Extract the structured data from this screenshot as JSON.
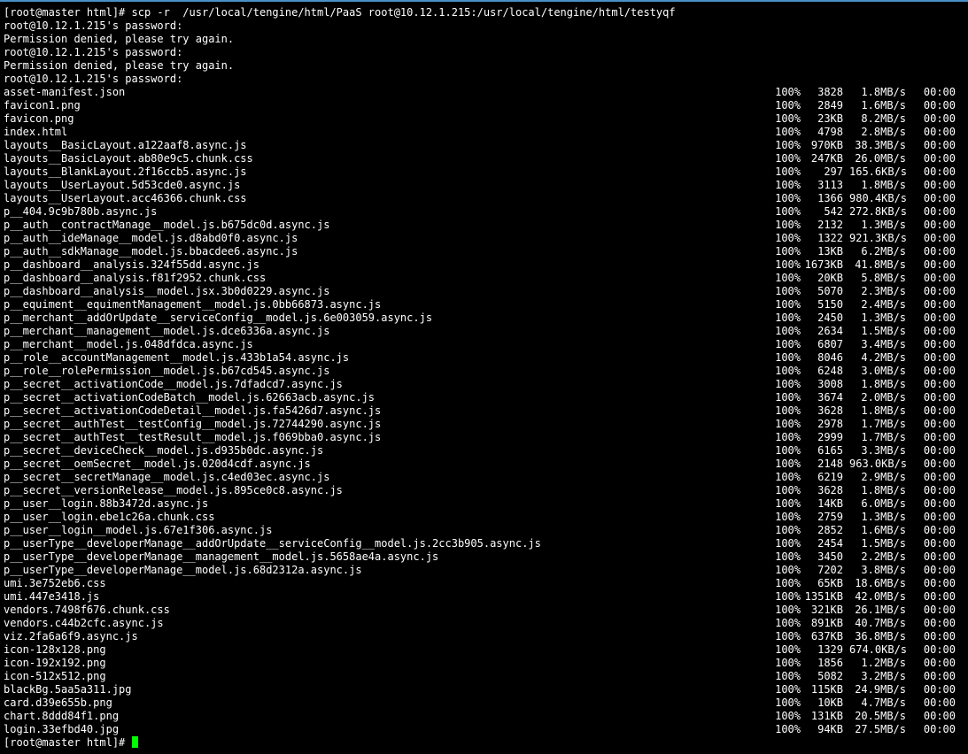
{
  "terminal": {
    "command_line": "[root@master html]# scp -r  /usr/local/tengine/html/PaaS root@10.12.1.215:/usr/local/tengine/html/testyqf",
    "auth_messages": [
      "root@10.12.1.215's password:",
      "Permission denied, please try again.",
      "root@10.12.1.215's password:",
      "Permission denied, please try again.",
      "root@10.12.1.215's password:"
    ],
    "transfers": [
      {
        "file": "asset-manifest.json",
        "pct": "100%",
        "size": "3828",
        "rate": "1.8MB/s",
        "eta": "00:00"
      },
      {
        "file": "favicon1.png",
        "pct": "100%",
        "size": "2849",
        "rate": "1.6MB/s",
        "eta": "00:00"
      },
      {
        "file": "favicon.png",
        "pct": "100%",
        "size": "23KB",
        "rate": "8.2MB/s",
        "eta": "00:00"
      },
      {
        "file": "index.html",
        "pct": "100%",
        "size": "4798",
        "rate": "2.8MB/s",
        "eta": "00:00"
      },
      {
        "file": "layouts__BasicLayout.a122aaf8.async.js",
        "pct": "100%",
        "size": "970KB",
        "rate": "38.3MB/s",
        "eta": "00:00"
      },
      {
        "file": "layouts__BasicLayout.ab80e9c5.chunk.css",
        "pct": "100%",
        "size": "247KB",
        "rate": "26.0MB/s",
        "eta": "00:00"
      },
      {
        "file": "layouts__BlankLayout.2f16ccb5.async.js",
        "pct": "100%",
        "size": "297",
        "rate": "165.6KB/s",
        "eta": "00:00"
      },
      {
        "file": "layouts__UserLayout.5d53cde0.async.js",
        "pct": "100%",
        "size": "3113",
        "rate": "1.8MB/s",
        "eta": "00:00"
      },
      {
        "file": "layouts__UserLayout.acc46366.chunk.css",
        "pct": "100%",
        "size": "1366",
        "rate": "980.4KB/s",
        "eta": "00:00"
      },
      {
        "file": "p__404.9c9b780b.async.js",
        "pct": "100%",
        "size": "542",
        "rate": "272.8KB/s",
        "eta": "00:00"
      },
      {
        "file": "p__auth__contractManage__model.js.b675dc0d.async.js",
        "pct": "100%",
        "size": "2132",
        "rate": "1.3MB/s",
        "eta": "00:00"
      },
      {
        "file": "p__auth__ideManage__model.js.d8abd0f0.async.js",
        "pct": "100%",
        "size": "1322",
        "rate": "921.3KB/s",
        "eta": "00:00"
      },
      {
        "file": "p__auth__sdkManage__model.js.bbacdee6.async.js",
        "pct": "100%",
        "size": "13KB",
        "rate": "6.2MB/s",
        "eta": "00:00"
      },
      {
        "file": "p__dashboard__analysis.324f55dd.async.js",
        "pct": "100%",
        "size": "1673KB",
        "rate": "41.8MB/s",
        "eta": "00:00"
      },
      {
        "file": "p__dashboard__analysis.f81f2952.chunk.css",
        "pct": "100%",
        "size": "20KB",
        "rate": "5.8MB/s",
        "eta": "00:00"
      },
      {
        "file": "p__dashboard__analysis__model.jsx.3b0d0229.async.js",
        "pct": "100%",
        "size": "5070",
        "rate": "2.3MB/s",
        "eta": "00:00"
      },
      {
        "file": "p__equiment__equimentManagement__model.js.0bb66873.async.js",
        "pct": "100%",
        "size": "5150",
        "rate": "2.4MB/s",
        "eta": "00:00"
      },
      {
        "file": "p__merchant__addOrUpdate__serviceConfig__model.js.6e003059.async.js",
        "pct": "100%",
        "size": "2450",
        "rate": "1.3MB/s",
        "eta": "00:00"
      },
      {
        "file": "p__merchant__management__model.js.dce6336a.async.js",
        "pct": "100%",
        "size": "2634",
        "rate": "1.5MB/s",
        "eta": "00:00"
      },
      {
        "file": "p__merchant__model.js.048dfdca.async.js",
        "pct": "100%",
        "size": "6807",
        "rate": "3.4MB/s",
        "eta": "00:00"
      },
      {
        "file": "p__role__accountManagement__model.js.433b1a54.async.js",
        "pct": "100%",
        "size": "8046",
        "rate": "4.2MB/s",
        "eta": "00:00"
      },
      {
        "file": "p__role__rolePermission__model.js.b67cd545.async.js",
        "pct": "100%",
        "size": "6248",
        "rate": "3.0MB/s",
        "eta": "00:00"
      },
      {
        "file": "p__secret__activationCode__model.js.7dfadcd7.async.js",
        "pct": "100%",
        "size": "3008",
        "rate": "1.8MB/s",
        "eta": "00:00"
      },
      {
        "file": "p__secret__activationCodeBatch__model.js.62663acb.async.js",
        "pct": "100%",
        "size": "3674",
        "rate": "2.0MB/s",
        "eta": "00:00"
      },
      {
        "file": "p__secret__activationCodeDetail__model.js.fa5426d7.async.js",
        "pct": "100%",
        "size": "3628",
        "rate": "1.8MB/s",
        "eta": "00:00"
      },
      {
        "file": "p__secret__authTest__testConfig__model.js.72744290.async.js",
        "pct": "100%",
        "size": "2978",
        "rate": "1.7MB/s",
        "eta": "00:00"
      },
      {
        "file": "p__secret__authTest__testResult__model.js.f069bba0.async.js",
        "pct": "100%",
        "size": "2999",
        "rate": "1.7MB/s",
        "eta": "00:00"
      },
      {
        "file": "p__secret__deviceCheck__model.js.d935b0dc.async.js",
        "pct": "100%",
        "size": "6165",
        "rate": "3.3MB/s",
        "eta": "00:00"
      },
      {
        "file": "p__secret__oemSecret__model.js.020d4cdf.async.js",
        "pct": "100%",
        "size": "2148",
        "rate": "963.0KB/s",
        "eta": "00:00"
      },
      {
        "file": "p__secret__secretManage__model.js.c4ed03ec.async.js",
        "pct": "100%",
        "size": "6219",
        "rate": "2.9MB/s",
        "eta": "00:00"
      },
      {
        "file": "p__secret__versionRelease__model.js.895ce0c8.async.js",
        "pct": "100%",
        "size": "3628",
        "rate": "1.8MB/s",
        "eta": "00:00"
      },
      {
        "file": "p__user__login.88b3472d.async.js",
        "pct": "100%",
        "size": "14KB",
        "rate": "6.0MB/s",
        "eta": "00:00"
      },
      {
        "file": "p__user__login.ebe1c26a.chunk.css",
        "pct": "100%",
        "size": "2759",
        "rate": "1.3MB/s",
        "eta": "00:00"
      },
      {
        "file": "p__user__login__model.js.67e1f306.async.js",
        "pct": "100%",
        "size": "2852",
        "rate": "1.6MB/s",
        "eta": "00:00"
      },
      {
        "file": "p__userType__developerManage__addOrUpdate__serviceConfig__model.js.2cc3b905.async.js",
        "pct": "100%",
        "size": "2454",
        "rate": "1.5MB/s",
        "eta": "00:00"
      },
      {
        "file": "p__userType__developerManage__management__model.js.5658ae4a.async.js",
        "pct": "100%",
        "size": "3450",
        "rate": "2.2MB/s",
        "eta": "00:00"
      },
      {
        "file": "p__userType__developerManage__model.js.68d2312a.async.js",
        "pct": "100%",
        "size": "7202",
        "rate": "3.8MB/s",
        "eta": "00:00"
      },
      {
        "file": "umi.3e752eb6.css",
        "pct": "100%",
        "size": "65KB",
        "rate": "18.6MB/s",
        "eta": "00:00"
      },
      {
        "file": "umi.447e3418.js",
        "pct": "100%",
        "size": "1351KB",
        "rate": "42.0MB/s",
        "eta": "00:00"
      },
      {
        "file": "vendors.7498f676.chunk.css",
        "pct": "100%",
        "size": "321KB",
        "rate": "26.1MB/s",
        "eta": "00:00"
      },
      {
        "file": "vendors.c44b2cfc.async.js",
        "pct": "100%",
        "size": "891KB",
        "rate": "40.7MB/s",
        "eta": "00:00"
      },
      {
        "file": "viz.2fa6a6f9.async.js",
        "pct": "100%",
        "size": "637KB",
        "rate": "36.8MB/s",
        "eta": "00:00"
      },
      {
        "file": "icon-128x128.png",
        "pct": "100%",
        "size": "1329",
        "rate": "674.0KB/s",
        "eta": "00:00"
      },
      {
        "file": "icon-192x192.png",
        "pct": "100%",
        "size": "1856",
        "rate": "1.2MB/s",
        "eta": "00:00"
      },
      {
        "file": "icon-512x512.png",
        "pct": "100%",
        "size": "5082",
        "rate": "3.2MB/s",
        "eta": "00:00"
      },
      {
        "file": "blackBg.5aa5a311.jpg",
        "pct": "100%",
        "size": "115KB",
        "rate": "24.9MB/s",
        "eta": "00:00"
      },
      {
        "file": "card.d39e655b.png",
        "pct": "100%",
        "size": "10KB",
        "rate": "4.7MB/s",
        "eta": "00:00"
      },
      {
        "file": "chart.8ddd84f1.png",
        "pct": "100%",
        "size": "131KB",
        "rate": "20.5MB/s",
        "eta": "00:00"
      },
      {
        "file": "login.33efbd40.jpg",
        "pct": "100%",
        "size": "94KB",
        "rate": "27.5MB/s",
        "eta": "00:00"
      }
    ],
    "prompt": "[root@master html]# ",
    "cursor_color": "#00ff00",
    "background_color": "#000000",
    "text_color": "#ffffff"
  }
}
